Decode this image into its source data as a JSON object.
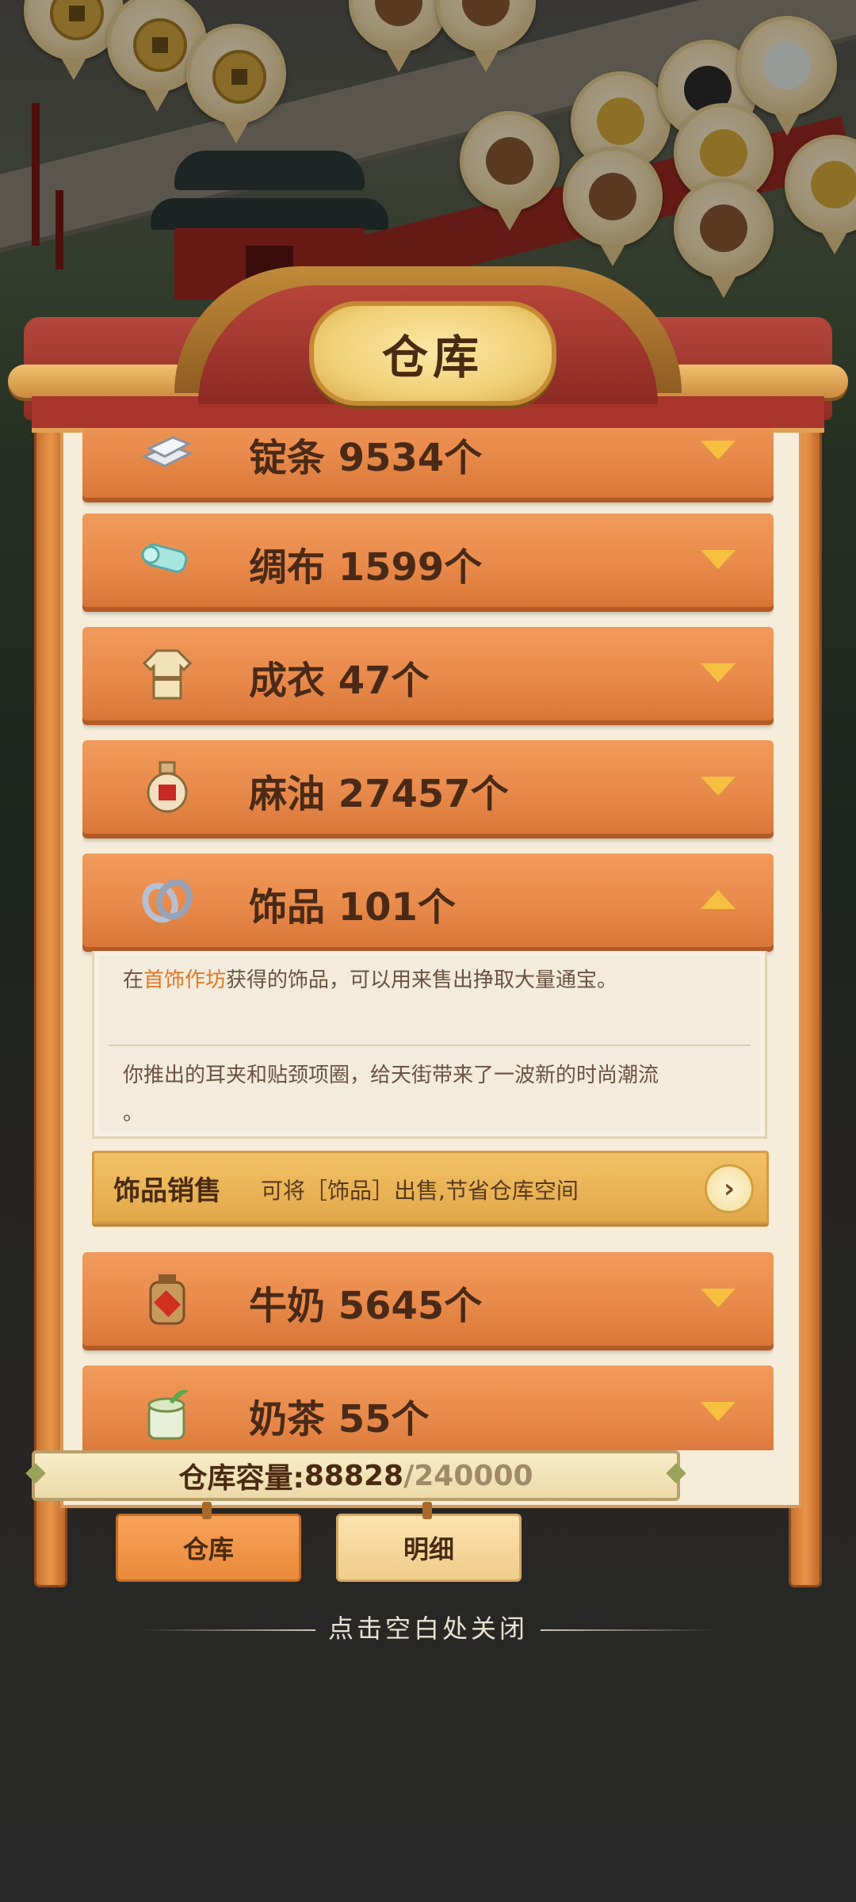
{
  "window": {
    "title": "仓库"
  },
  "items": [
    {
      "name": "锭条",
      "count": "9534个",
      "label": "锭条 9534个",
      "icon": "silver-ingot-icon",
      "expanded": false
    },
    {
      "name": "绸布",
      "count": "1599个",
      "label": "绸布 1599个",
      "icon": "silk-cloth-icon",
      "expanded": false
    },
    {
      "name": "成衣",
      "count": "47个",
      "label": "成衣 47个",
      "icon": "garment-icon",
      "expanded": false
    },
    {
      "name": "麻油",
      "count": "27457个",
      "label": "麻油 27457个",
      "icon": "sesame-oil-jar-icon",
      "expanded": false
    },
    {
      "name": "饰品",
      "count": "101个",
      "label": "饰品 101个",
      "icon": "rings-icon",
      "expanded": true
    },
    {
      "name": "牛奶",
      "count": "5645个",
      "label": "牛奶 5645个",
      "icon": "milk-jar-icon",
      "expanded": false
    },
    {
      "name": "奶茶",
      "count": "55个",
      "label": "奶茶 55个",
      "icon": "milk-tea-icon",
      "expanded": false
    }
  ],
  "detail": {
    "line1_pre": "在",
    "line1_link": "首饰作坊",
    "line1_post": "获得的饰品，可以用来售出挣取大量通宝。",
    "line2": "你推出的耳夹和贴颈项圈，给天街带来了一波新的时尚潮流",
    "line3": "。"
  },
  "sale": {
    "title": "饰品销售",
    "text": "可将［饰品］出售,节省仓库空间"
  },
  "capacity": {
    "label": "仓库容量:",
    "current": "88828",
    "max": "/240000"
  },
  "tabs": [
    {
      "label": "仓库",
      "active": true
    },
    {
      "label": "明细",
      "active": false
    }
  ],
  "close_hint": "点击空白处关闭",
  "colors": {
    "row": "#e88a4b",
    "accent": "#e0782a",
    "title_plaque": "#f1d27a",
    "roof": "#a8342c"
  }
}
